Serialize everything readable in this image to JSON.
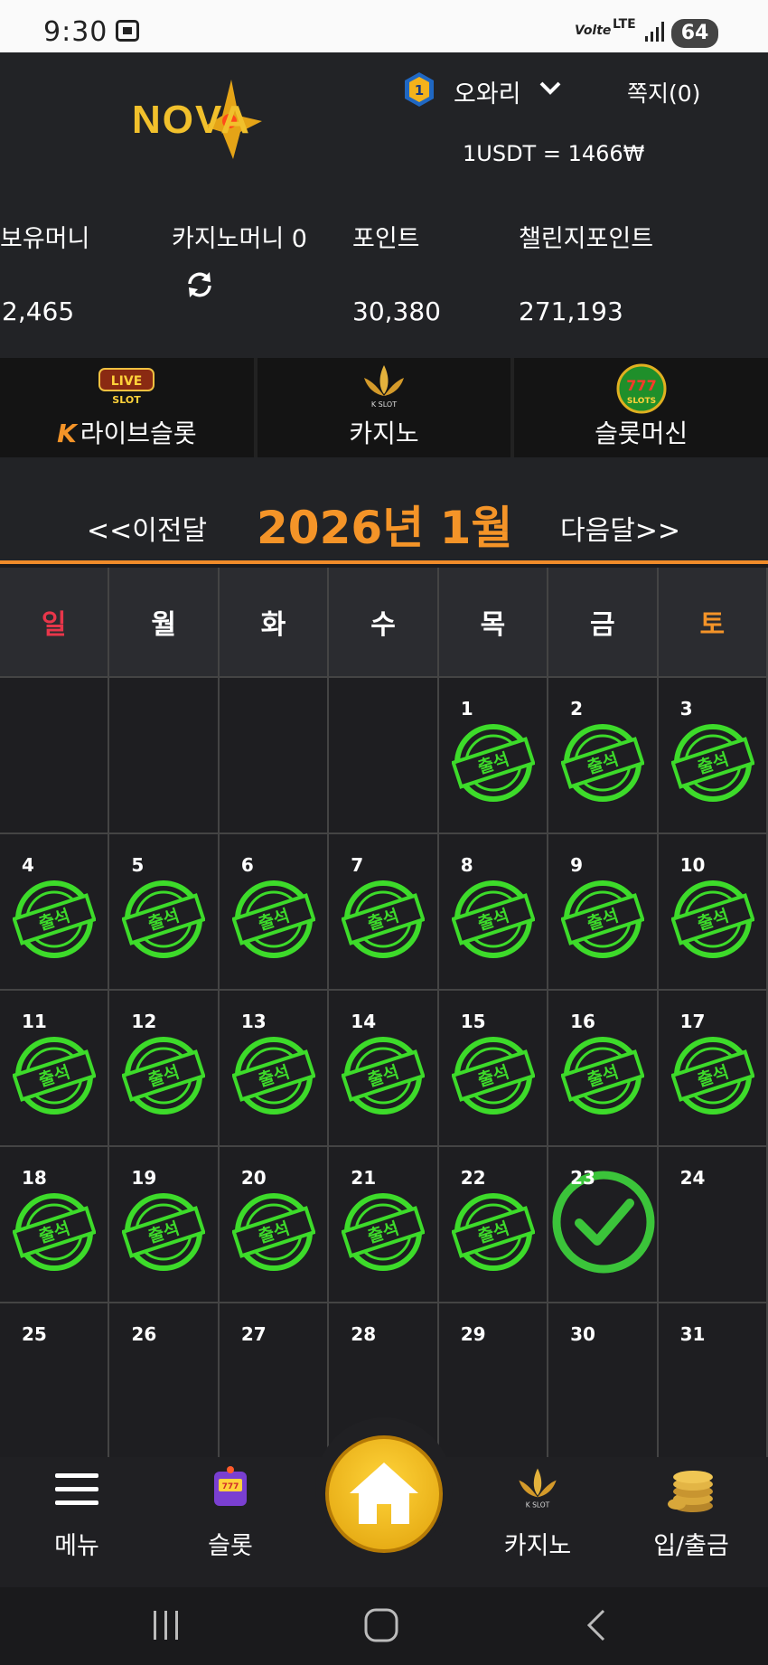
{
  "status_bar": {
    "time": "9:30",
    "network": "Volte",
    "lte": "LTE",
    "battery": "64"
  },
  "header": {
    "logo": "NOVA",
    "rank": "1",
    "username": "오와리",
    "messages": "쪽지(0)",
    "rate": "1USDT = 1466₩"
  },
  "balances": {
    "hold_label": "보유머니",
    "hold_value": "2,465",
    "casino_label": "카지노머니 0",
    "point_label": "포인트",
    "point_value": "30,380",
    "challenge_label": "챌린지포인트",
    "challenge_value": "271,193"
  },
  "categories": [
    {
      "label": "라이브슬롯",
      "badge": "LIVE SLOT",
      "prefix": "K"
    },
    {
      "label": "카지노",
      "badge": "K SLOT"
    },
    {
      "label": "슬롯머신",
      "badge": "777 SLOTS"
    }
  ],
  "month_nav": {
    "prev": "<<이전달",
    "title": "2026년 1월",
    "next": "다음달>>"
  },
  "calendar": {
    "weekdays": [
      "일",
      "월",
      "화",
      "수",
      "목",
      "금",
      "토"
    ],
    "stamp_text": "출석",
    "cells": [
      "",
      "",
      "",
      "",
      "1",
      "2",
      "3",
      "4",
      "5",
      "6",
      "7",
      "8",
      "9",
      "10",
      "11",
      "12",
      "13",
      "14",
      "15",
      "16",
      "17",
      "18",
      "19",
      "20",
      "21",
      "22",
      "23",
      "24",
      "25",
      "26",
      "27",
      "28",
      "29",
      "30",
      "31"
    ],
    "attended_days": [
      "1",
      "2",
      "3",
      "4",
      "5",
      "6",
      "7",
      "8",
      "9",
      "10",
      "11",
      "12",
      "13",
      "14",
      "15",
      "16",
      "17",
      "18",
      "19",
      "20",
      "21",
      "22"
    ],
    "today": "23"
  },
  "bottom_nav": {
    "menu": "메뉴",
    "slot": "슬롯",
    "casino": "카지노",
    "deposit": "입/출금"
  },
  "colors": {
    "accent": "#f49428",
    "stamp_green": "#3ddb2a",
    "sunday": "#e8364a",
    "saturday": "#f49428"
  }
}
